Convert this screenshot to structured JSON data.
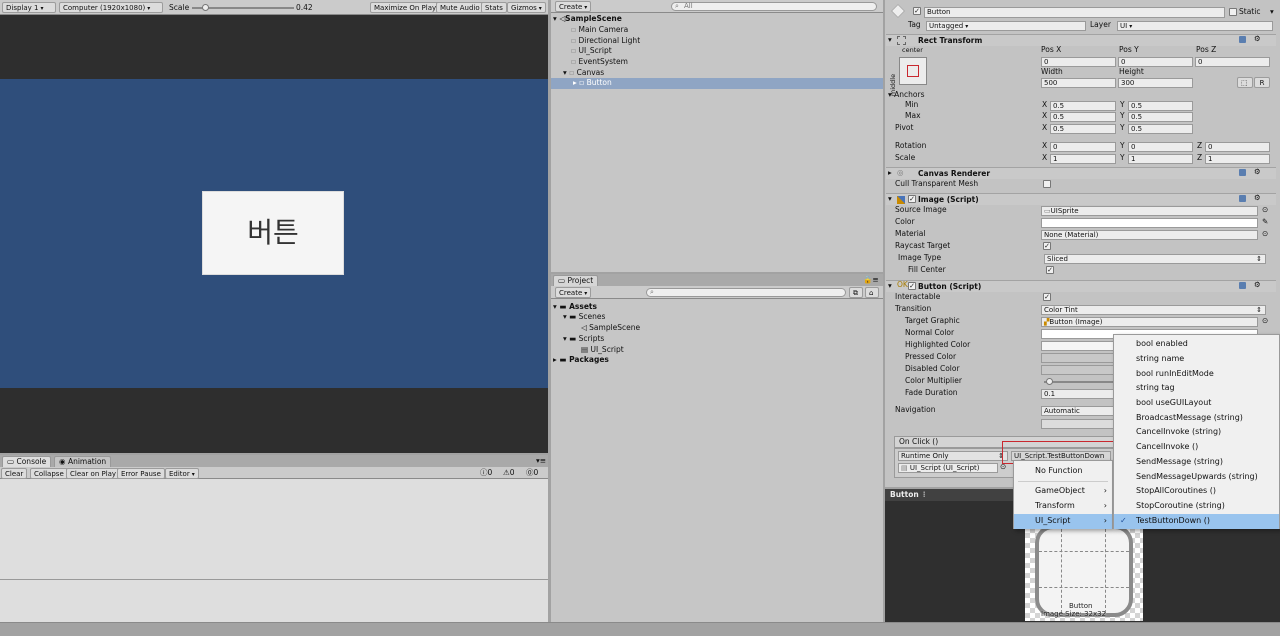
{
  "game": {
    "display": "Display 1",
    "resolution": "Computer (1920x1080)",
    "scale_label": "Scale",
    "scale_value": "0.42",
    "scale_level": 0.1,
    "maximize": "Maximize On Play",
    "mute": "Mute Audio",
    "stats": "Stats",
    "gizmos": "Gizmos",
    "button_text": "버튼"
  },
  "hierarchy": {
    "create": "Create",
    "search": "All",
    "scene": "SampleScene",
    "items": [
      "Main Camera",
      "Directional Light",
      "UI_Script",
      "EventSystem",
      "Canvas",
      "Button"
    ]
  },
  "project": {
    "tab": "Project",
    "create": "Create",
    "assets": "Assets",
    "scenes": "Scenes",
    "sample_scene": "SampleScene",
    "scripts": "Scripts",
    "ui_script": "UI_Script",
    "packages": "Packages"
  },
  "console": {
    "tab_console": "Console",
    "tab_animation": "Animation",
    "clear": "Clear",
    "collapse": "Collapse",
    "clear_on_play": "Clear on Play",
    "error_pause": "Error Pause",
    "editor": "Editor",
    "count_info": "0",
    "count_warn": "0",
    "count_err": "0"
  },
  "inspector": {
    "object_name": "Button",
    "static": "Static",
    "tag_label": "Tag",
    "tag_value": "Untagged",
    "layer_label": "Layer",
    "layer_value": "UI",
    "rect": {
      "title": "Rect Transform",
      "center": "center",
      "middle": "middle",
      "posx": "Pos X",
      "posy": "Pos Y",
      "posz": "Pos Z",
      "px": "0",
      "py": "0",
      "pz": "0",
      "width_label": "Width",
      "height_label": "Height",
      "width": "500",
      "height": "300",
      "r_btn": "R",
      "anchors": "Anchors",
      "min": "Min",
      "max": "Max",
      "pivot": "Pivot",
      "min_x": "0.5",
      "min_y": "0.5",
      "max_x": "0.5",
      "max_y": "0.5",
      "pivot_x": "0.5",
      "pivot_y": "0.5",
      "rotation": "Rotation",
      "rot_x": "0",
      "rot_y": "0",
      "rot_z": "0",
      "scale": "Scale",
      "sc_x": "1",
      "sc_y": "1",
      "sc_z": "1",
      "x": "X",
      "y": "Y",
      "z": "Z"
    },
    "canvas_renderer": {
      "title": "Canvas Renderer",
      "cull": "Cull Transparent Mesh"
    },
    "image": {
      "title": "Image (Script)",
      "source_label": "Source Image",
      "source_value": "UISprite",
      "color_label": "Color",
      "material_label": "Material",
      "material_value": "None (Material)",
      "raycast_label": "Raycast Target",
      "type_label": "Image Type",
      "type_value": "Sliced",
      "fill_center": "Fill Center"
    },
    "button": {
      "title": "Button (Script)",
      "interactable": "Interactable",
      "transition_label": "Transition",
      "transition_value": "Color Tint",
      "target_label": "Target Graphic",
      "target_value": "Button (Image)",
      "normal": "Normal Color",
      "highlighted": "Highlighted Color",
      "pressed": "Pressed Color",
      "disabled": "Disabled Color",
      "multiplier": "Color Multiplier",
      "multiplier_level": 0.1,
      "fade_label": "Fade Duration",
      "fade_value": "0.1",
      "navigation_label": "Navigation",
      "navigation_value": "Automatic",
      "onclick": "On Click ()",
      "runtime": "Runtime Only",
      "function": "UI_Script.TestButtonDown",
      "object": "UI_Script (UI_Script)"
    },
    "preview_title": "Button",
    "preview_caption": "Button",
    "preview_size": "Image Size: 32x32"
  },
  "menu_left": {
    "no_function": "No Function",
    "items": [
      "GameObject",
      "Transform",
      "UI_Script"
    ]
  },
  "menu_right": {
    "items": [
      "bool enabled",
      "string name",
      "bool runInEditMode",
      "string tag",
      "bool useGUILayout",
      "BroadcastMessage (string)",
      "CancelInvoke (string)",
      "CancelInvoke ()",
      "SendMessage (string)",
      "SendMessageUpwards (string)",
      "StopAllCoroutines ()",
      "StopCoroutine (string)",
      "TestButtonDown ()"
    ],
    "checked": "✓"
  },
  "colors": {
    "canvas_blue": "#2f4e7b",
    "dark_bg": "#2e2e2e",
    "highlight": "#99c4ee",
    "selection": "#3d70c6",
    "red": "#c9282f"
  }
}
